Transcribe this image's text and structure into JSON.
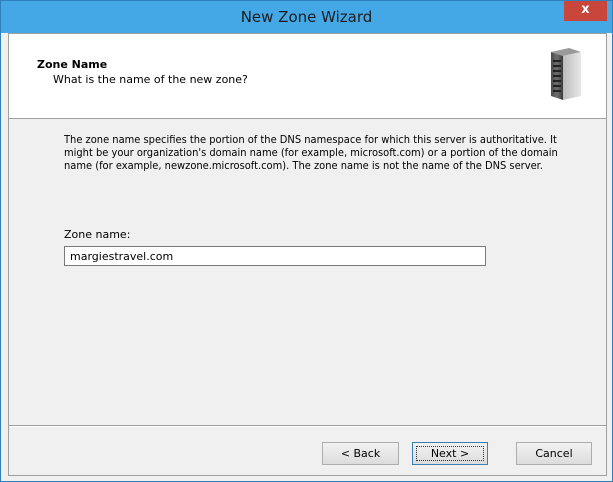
{
  "window": {
    "title": "New Zone Wizard",
    "close_glyph": "x",
    "close_icon": "close-icon"
  },
  "header": {
    "title": "Zone Name",
    "subtitle": "What is the name of the new zone?",
    "icon": "server-icon"
  },
  "content": {
    "description": "The zone name specifies the portion of the DNS namespace for which this server is authoritative. It might be your organization's domain name (for example,  microsoft.com) or a portion of the domain name (for example, newzone.microsoft.com). The zone name is not the name of the DNS server.",
    "zone_name_label": "Zone name:",
    "zone_name_value": "margiestravel.com"
  },
  "buttons": {
    "back": "< Back",
    "next": "Next >",
    "cancel": "Cancel"
  },
  "colors": {
    "titlebar": "#44a8e6",
    "close": "#c9463d",
    "dialog_bg": "#f0f0f0"
  }
}
